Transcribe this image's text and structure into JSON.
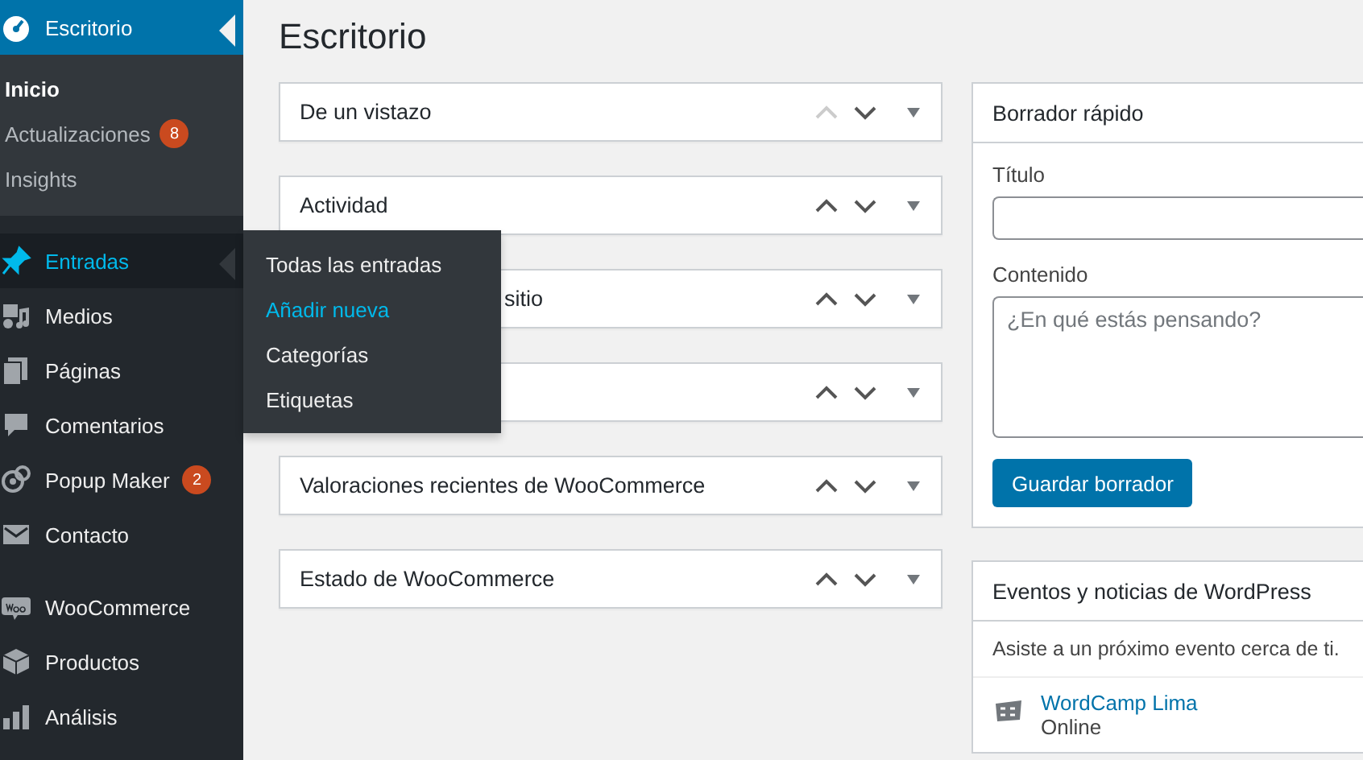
{
  "sidebar": {
    "groups": [
      [
        {
          "label": "Escritorio",
          "current": true,
          "hovered": false,
          "children": [
            {
              "label": "Inicio",
              "selected": true
            },
            {
              "label": "Actualizaciones",
              "selected": false,
              "badge": "8"
            },
            {
              "label": "Insights",
              "selected": false
            }
          ]
        }
      ],
      [
        {
          "label": "Entradas",
          "current": false,
          "hovered": true,
          "flyout": [
            {
              "label": "Todas las entradas",
              "selected": false
            },
            {
              "label": "Añadir nueva",
              "selected": true
            },
            {
              "label": "Categorías",
              "selected": false
            },
            {
              "label": "Etiquetas",
              "selected": false
            }
          ]
        },
        {
          "label": "Medios",
          "current": false,
          "hovered": false
        },
        {
          "label": "Páginas",
          "current": false,
          "hovered": false
        },
        {
          "label": "Comentarios",
          "current": false,
          "hovered": false
        },
        {
          "label": "Popup Maker",
          "current": false,
          "hovered": false,
          "badge": "2"
        },
        {
          "label": "Contacto",
          "current": false,
          "hovered": false
        }
      ],
      [
        {
          "label": "WooCommerce",
          "current": false,
          "hovered": false
        },
        {
          "label": "Productos",
          "current": false,
          "hovered": false
        },
        {
          "label": "Análisis",
          "current": false,
          "hovered": false
        }
      ]
    ]
  },
  "page_title": "Escritorio",
  "widgets_left": [
    {
      "kind": "plain",
      "title": "De un vistazo",
      "up_disabled": true
    },
    {
      "kind": "plain",
      "title": "Actividad",
      "up_disabled": false
    },
    {
      "kind": "covered",
      "title": "sitio",
      "up_disabled": false
    },
    {
      "kind": "covered",
      "up_disabled": false
    },
    {
      "kind": "plain",
      "title": "Valoraciones recientes de WooCommerce",
      "up_disabled": false
    },
    {
      "kind": "plain",
      "title": "Estado de WooCommerce",
      "up_disabled": false
    }
  ],
  "quick_draft": {
    "title": "Borrador rápido",
    "title_label": "Título",
    "content_label": "Contenido",
    "content_placeholder": "¿En qué estás pensando?",
    "button": "Guardar borrador"
  },
  "events": {
    "title": "Eventos y noticias de WordPress",
    "intro": "Asiste a un próximo evento cerca de ti.",
    "items": [
      {
        "name": "WordCamp Lima",
        "location": "Online"
      }
    ]
  }
}
